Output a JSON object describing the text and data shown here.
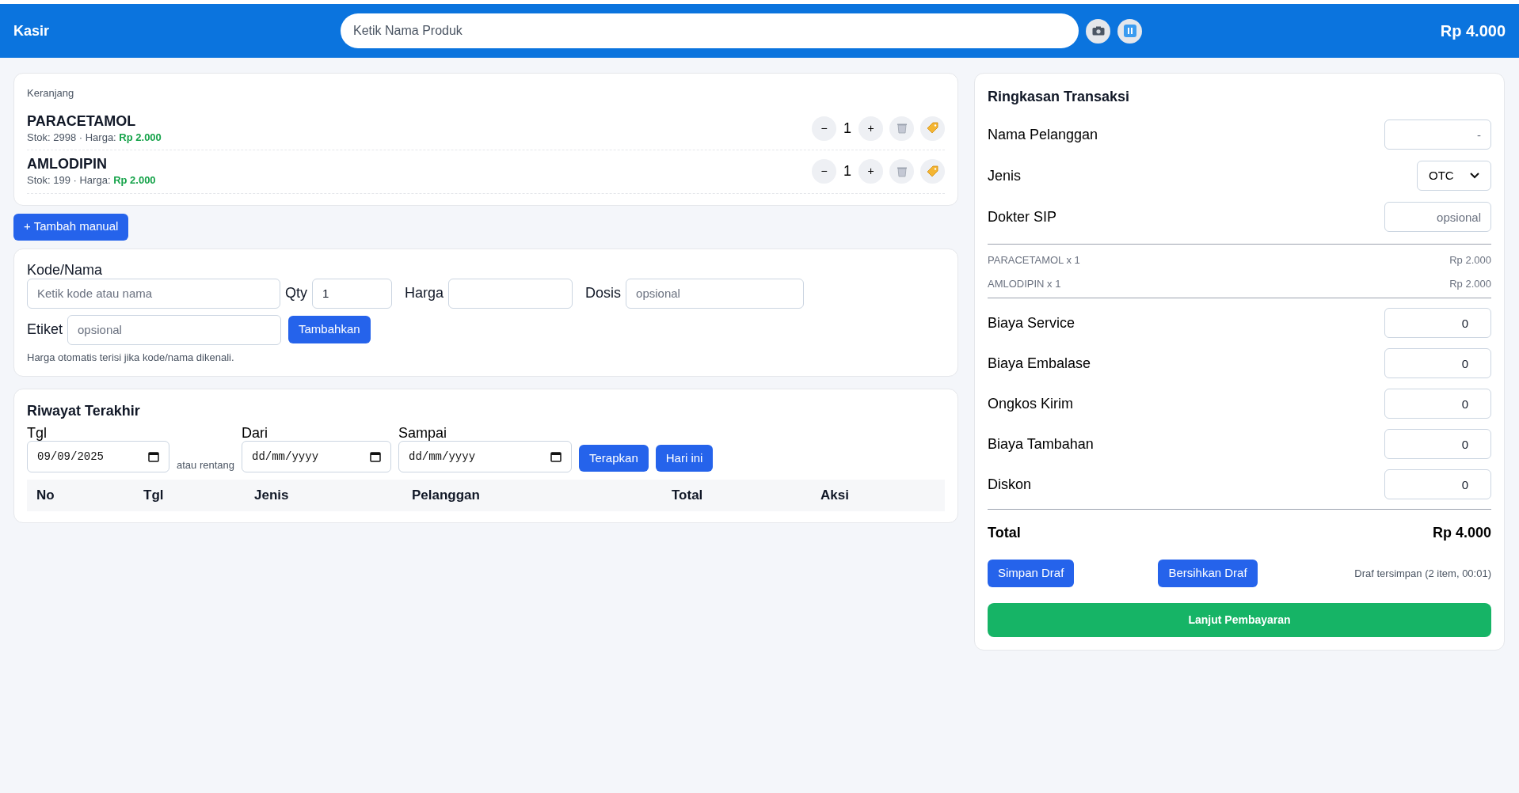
{
  "header": {
    "title": "Kasir",
    "search": {
      "placeholder": "Ketik Nama Produk"
    },
    "total": "Rp 4.000"
  },
  "cart": {
    "label": "Keranjang",
    "items": [
      {
        "name": "PARACETAMOL",
        "stock": "Stok: 2998 · Harga:",
        "price": "Rp 2.000",
        "qty": "1",
        "minus": "−",
        "plus": "+"
      },
      {
        "name": "AMLODIPIN",
        "stock": "Stok: 199 · Harga:",
        "price": "Rp 2.000",
        "qty": "1",
        "minus": "−",
        "plus": "+"
      }
    ]
  },
  "add_manual_button": "+ Tambah manual",
  "manual_form": {
    "fields": [
      {
        "label": "Kode/Nama",
        "placeholder": "Ketik kode atau nama"
      },
      {
        "label": "Qty",
        "value": "1"
      },
      {
        "label": "Harga"
      },
      {
        "label": "Dosis",
        "placeholder": "opsional"
      },
      {
        "label": "Etiket",
        "placeholder": "opsional"
      }
    ],
    "submit": "Tambahkan",
    "hint": "Harga otomatis terisi jika kode/nama dikenali."
  },
  "history": {
    "title": "Riwayat Terakhir",
    "date": {
      "label": "Tgl",
      "value": "09/09/2025"
    },
    "or_range": "atau rentang",
    "from": {
      "label": "Dari",
      "value": "dd/mm/yyyy"
    },
    "to": {
      "label": "Sampai",
      "value": "dd/mm/yyyy"
    },
    "buttons": [
      "Terapkan",
      "Hari ini"
    ],
    "columns": [
      "No",
      "Tgl",
      "Jenis",
      "Pelanggan",
      "Total",
      "Aksi"
    ]
  },
  "summary": {
    "title": "Ringkasan Transaksi",
    "customer": {
      "label": "Nama Pelanggan",
      "placeholder": "-"
    },
    "type": {
      "label": "Jenis",
      "value": "OTC"
    },
    "doctor": {
      "label": "Dokter SIP",
      "placeholder": "opsional"
    },
    "lines": [
      {
        "name": "PARACETAMOL x 1",
        "amount": "Rp 2.000"
      },
      {
        "name": "AMLODIPIN x 1",
        "amount": "Rp 2.000"
      }
    ],
    "fees": [
      {
        "label": "Biaya Service",
        "value": "0"
      },
      {
        "label": "Biaya Embalase",
        "value": "0"
      },
      {
        "label": "Ongkos Kirim",
        "value": "0"
      },
      {
        "label": "Biaya Tambahan",
        "value": "0"
      },
      {
        "label": "Diskon",
        "value": "0"
      }
    ],
    "total_label": "Total",
    "total": "Rp 4.000",
    "save_draft": "Simpan Draf",
    "clear_draft": "Bersihkan Draf",
    "draft_status": "Draf tersimpan (2 item, 00:01)",
    "pay": "Lanjut Pembayaran"
  }
}
